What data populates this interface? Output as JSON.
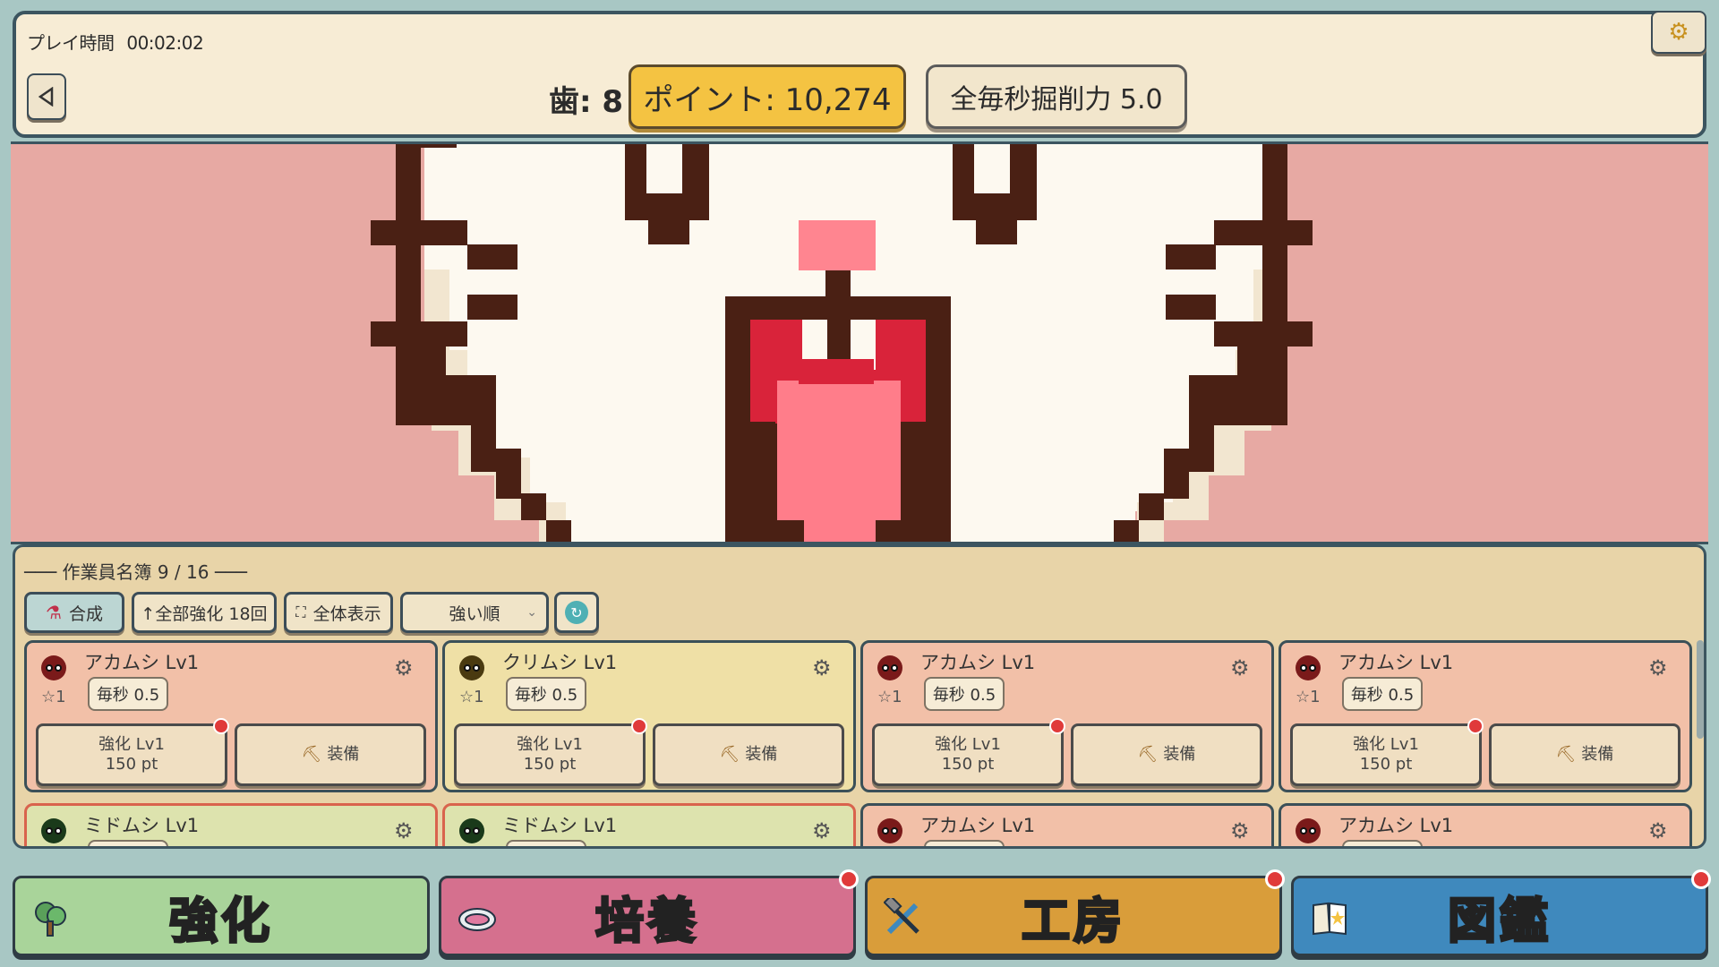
{
  "header": {
    "playtime_label": "プレイ時間",
    "playtime": "00:02:02",
    "teeth": "歯: 8",
    "points": "ポイント: 10,274",
    "dig_power": "全毎秒掘削力 5.0"
  },
  "roster": {
    "title": "─── 作業員名簿 9 / 16 ───",
    "buttons": {
      "combine": "合成",
      "upgrade_all": "↑全部強化 18回",
      "show_all": "全体表示",
      "sort": "強い順"
    },
    "cards": [
      {
        "name": "アカムシ  Lv1",
        "star": "☆1",
        "rate": "毎秒 0.5",
        "upgrade_line1": "強化 Lv1",
        "upgrade_line2": "150 pt",
        "equip": "装備",
        "color": "#7a1a1a"
      },
      {
        "name": "クリムシ  Lv1",
        "star": "☆1",
        "rate": "毎秒 0.5",
        "upgrade_line1": "強化 Lv1",
        "upgrade_line2": "150 pt",
        "equip": "装備",
        "color": "#4a3a10"
      },
      {
        "name": "アカムシ  Lv1",
        "star": "☆1",
        "rate": "毎秒 0.5",
        "upgrade_line1": "強化 Lv1",
        "upgrade_line2": "150 pt",
        "equip": "装備",
        "color": "#7a1a1a"
      },
      {
        "name": "アカムシ  Lv1",
        "star": "☆1",
        "rate": "毎秒 0.5",
        "upgrade_line1": "強化 Lv1",
        "upgrade_line2": "150 pt",
        "equip": "装備",
        "color": "#7a1a1a"
      },
      {
        "name": "ミドムシ  Lv1",
        "color": "#1a3a1a"
      },
      {
        "name": "ミドムシ  Lv1",
        "color": "#1a3a1a"
      },
      {
        "name": "アカムシ  Lv1",
        "color": "#7a1a1a"
      },
      {
        "name": "アカムシ  Lv1",
        "color": "#7a1a1a"
      }
    ]
  },
  "nav": {
    "upgrade": "強化",
    "culture": "培養",
    "workshop": "工房",
    "zukan": "図鑑"
  },
  "colors": {
    "header_bg": "#f7ecd5",
    "points_pill": "#f4c342",
    "game_bg": "#e7a9a3",
    "nav_upgrade": "#a9d49a",
    "nav_culture": "#d5708e",
    "nav_workshop": "#d99d3a",
    "nav_zukan": "#3f89bd"
  }
}
